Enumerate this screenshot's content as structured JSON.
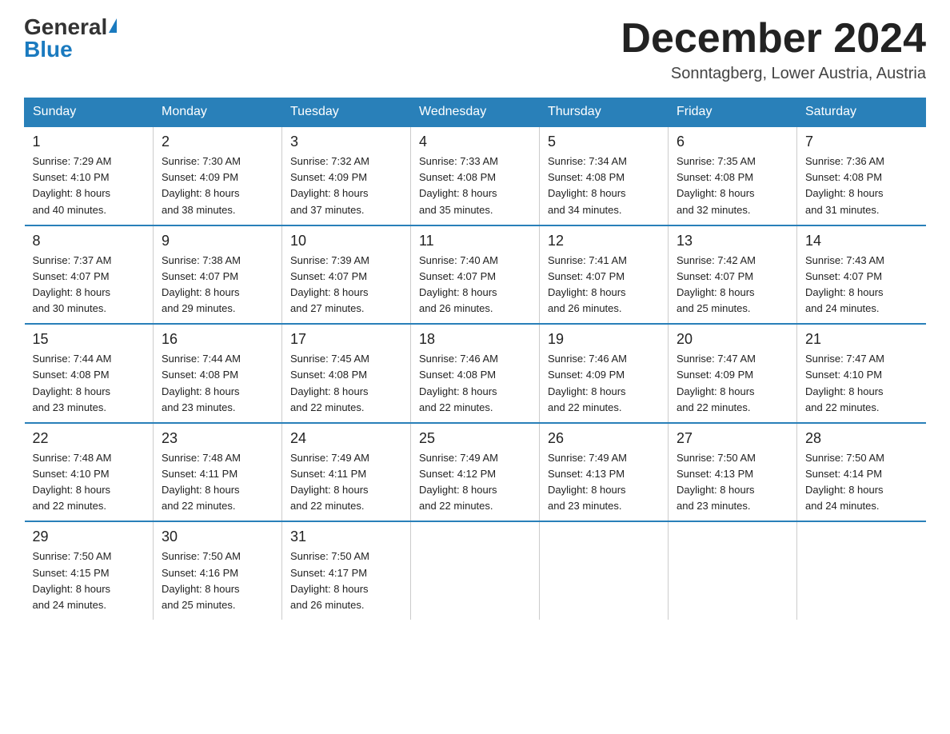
{
  "header": {
    "logo_general": "General",
    "logo_blue": "Blue",
    "month_title": "December 2024",
    "location": "Sonntagberg, Lower Austria, Austria"
  },
  "days_of_week": [
    "Sunday",
    "Monday",
    "Tuesday",
    "Wednesday",
    "Thursday",
    "Friday",
    "Saturday"
  ],
  "weeks": [
    [
      {
        "day": "1",
        "sunrise": "7:29 AM",
        "sunset": "4:10 PM",
        "daylight": "8 hours and 40 minutes."
      },
      {
        "day": "2",
        "sunrise": "7:30 AM",
        "sunset": "4:09 PM",
        "daylight": "8 hours and 38 minutes."
      },
      {
        "day": "3",
        "sunrise": "7:32 AM",
        "sunset": "4:09 PM",
        "daylight": "8 hours and 37 minutes."
      },
      {
        "day": "4",
        "sunrise": "7:33 AM",
        "sunset": "4:08 PM",
        "daylight": "8 hours and 35 minutes."
      },
      {
        "day": "5",
        "sunrise": "7:34 AM",
        "sunset": "4:08 PM",
        "daylight": "8 hours and 34 minutes."
      },
      {
        "day": "6",
        "sunrise": "7:35 AM",
        "sunset": "4:08 PM",
        "daylight": "8 hours and 32 minutes."
      },
      {
        "day": "7",
        "sunrise": "7:36 AM",
        "sunset": "4:08 PM",
        "daylight": "8 hours and 31 minutes."
      }
    ],
    [
      {
        "day": "8",
        "sunrise": "7:37 AM",
        "sunset": "4:07 PM",
        "daylight": "8 hours and 30 minutes."
      },
      {
        "day": "9",
        "sunrise": "7:38 AM",
        "sunset": "4:07 PM",
        "daylight": "8 hours and 29 minutes."
      },
      {
        "day": "10",
        "sunrise": "7:39 AM",
        "sunset": "4:07 PM",
        "daylight": "8 hours and 27 minutes."
      },
      {
        "day": "11",
        "sunrise": "7:40 AM",
        "sunset": "4:07 PM",
        "daylight": "8 hours and 26 minutes."
      },
      {
        "day": "12",
        "sunrise": "7:41 AM",
        "sunset": "4:07 PM",
        "daylight": "8 hours and 26 minutes."
      },
      {
        "day": "13",
        "sunrise": "7:42 AM",
        "sunset": "4:07 PM",
        "daylight": "8 hours and 25 minutes."
      },
      {
        "day": "14",
        "sunrise": "7:43 AM",
        "sunset": "4:07 PM",
        "daylight": "8 hours and 24 minutes."
      }
    ],
    [
      {
        "day": "15",
        "sunrise": "7:44 AM",
        "sunset": "4:08 PM",
        "daylight": "8 hours and 23 minutes."
      },
      {
        "day": "16",
        "sunrise": "7:44 AM",
        "sunset": "4:08 PM",
        "daylight": "8 hours and 23 minutes."
      },
      {
        "day": "17",
        "sunrise": "7:45 AM",
        "sunset": "4:08 PM",
        "daylight": "8 hours and 22 minutes."
      },
      {
        "day": "18",
        "sunrise": "7:46 AM",
        "sunset": "4:08 PM",
        "daylight": "8 hours and 22 minutes."
      },
      {
        "day": "19",
        "sunrise": "7:46 AM",
        "sunset": "4:09 PM",
        "daylight": "8 hours and 22 minutes."
      },
      {
        "day": "20",
        "sunrise": "7:47 AM",
        "sunset": "4:09 PM",
        "daylight": "8 hours and 22 minutes."
      },
      {
        "day": "21",
        "sunrise": "7:47 AM",
        "sunset": "4:10 PM",
        "daylight": "8 hours and 22 minutes."
      }
    ],
    [
      {
        "day": "22",
        "sunrise": "7:48 AM",
        "sunset": "4:10 PM",
        "daylight": "8 hours and 22 minutes."
      },
      {
        "day": "23",
        "sunrise": "7:48 AM",
        "sunset": "4:11 PM",
        "daylight": "8 hours and 22 minutes."
      },
      {
        "day": "24",
        "sunrise": "7:49 AM",
        "sunset": "4:11 PM",
        "daylight": "8 hours and 22 minutes."
      },
      {
        "day": "25",
        "sunrise": "7:49 AM",
        "sunset": "4:12 PM",
        "daylight": "8 hours and 22 minutes."
      },
      {
        "day": "26",
        "sunrise": "7:49 AM",
        "sunset": "4:13 PM",
        "daylight": "8 hours and 23 minutes."
      },
      {
        "day": "27",
        "sunrise": "7:50 AM",
        "sunset": "4:13 PM",
        "daylight": "8 hours and 23 minutes."
      },
      {
        "day": "28",
        "sunrise": "7:50 AM",
        "sunset": "4:14 PM",
        "daylight": "8 hours and 24 minutes."
      }
    ],
    [
      {
        "day": "29",
        "sunrise": "7:50 AM",
        "sunset": "4:15 PM",
        "daylight": "8 hours and 24 minutes."
      },
      {
        "day": "30",
        "sunrise": "7:50 AM",
        "sunset": "4:16 PM",
        "daylight": "8 hours and 25 minutes."
      },
      {
        "day": "31",
        "sunrise": "7:50 AM",
        "sunset": "4:17 PM",
        "daylight": "8 hours and 26 minutes."
      },
      null,
      null,
      null,
      null
    ]
  ],
  "labels": {
    "sunrise": "Sunrise:",
    "sunset": "Sunset:",
    "daylight": "Daylight:"
  }
}
